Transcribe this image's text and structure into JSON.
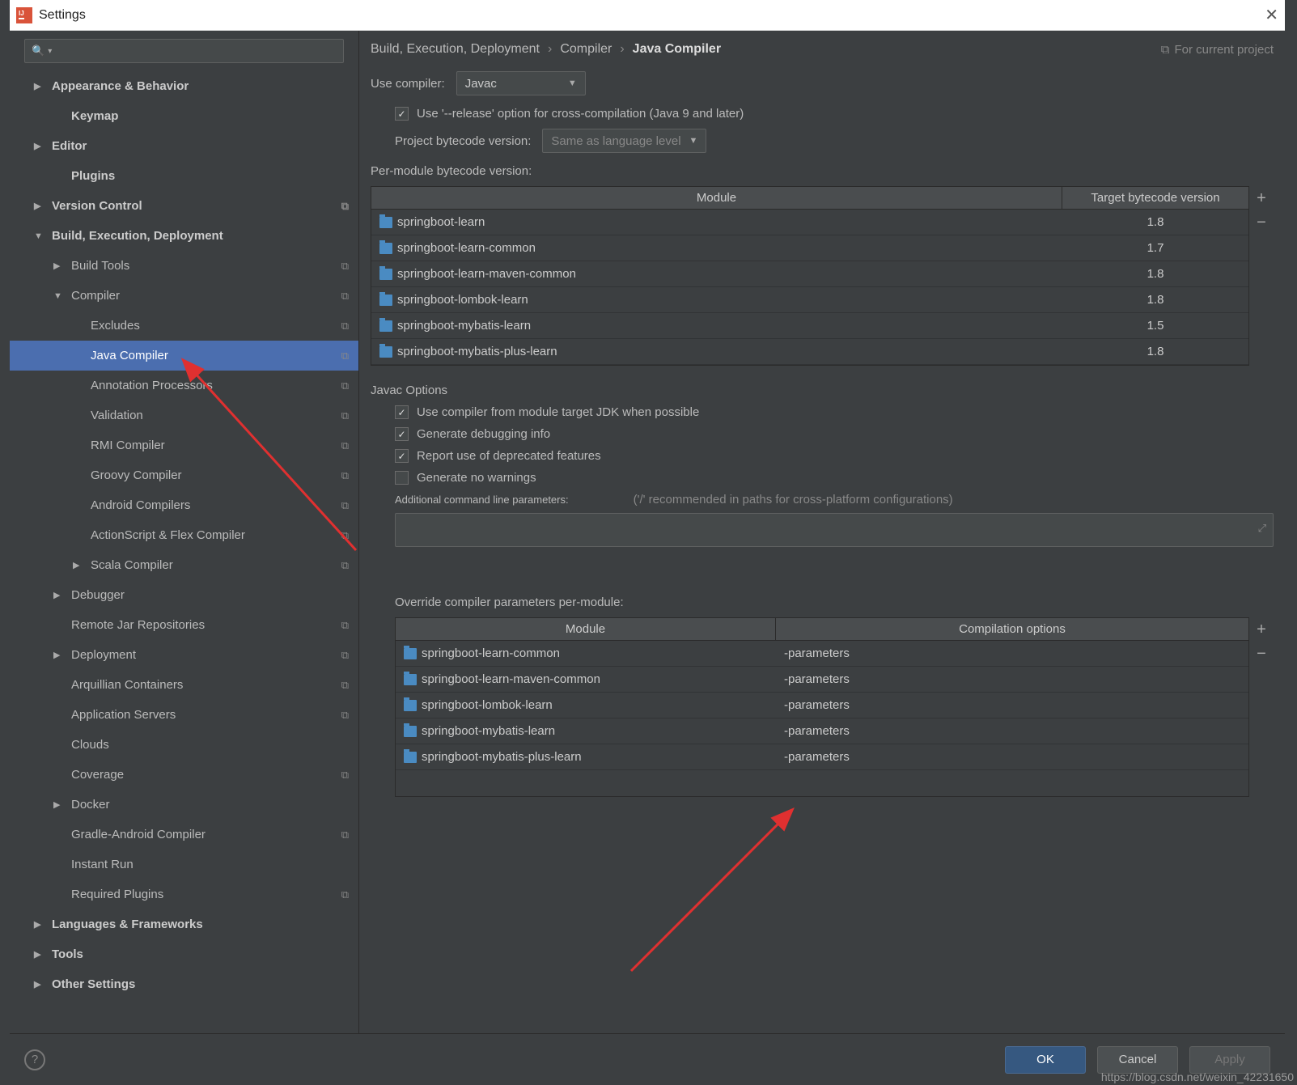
{
  "window": {
    "title": "Settings"
  },
  "sidebar": {
    "search_placeholder": "",
    "items": [
      {
        "label": "Appearance & Behavior",
        "bold": true,
        "exp": "▶",
        "indent": 0
      },
      {
        "label": "Keymap",
        "bold": true,
        "indent": 1
      },
      {
        "label": "Editor",
        "bold": true,
        "exp": "▶",
        "indent": 0
      },
      {
        "label": "Plugins",
        "bold": true,
        "indent": 1
      },
      {
        "label": "Version Control",
        "bold": true,
        "exp": "▶",
        "indent": 0,
        "copy": true
      },
      {
        "label": "Build, Execution, Deployment",
        "bold": true,
        "exp": "▼",
        "indent": 0
      },
      {
        "label": "Build Tools",
        "exp": "▶",
        "indent": 1,
        "copy": true
      },
      {
        "label": "Compiler",
        "exp": "▼",
        "indent": 1,
        "copy": true
      },
      {
        "label": "Excludes",
        "indent": 2,
        "copy": true
      },
      {
        "label": "Java Compiler",
        "indent": 2,
        "copy": true,
        "selected": true
      },
      {
        "label": "Annotation Processors",
        "indent": 2,
        "copy": true
      },
      {
        "label": "Validation",
        "indent": 2,
        "copy": true
      },
      {
        "label": "RMI Compiler",
        "indent": 2,
        "copy": true
      },
      {
        "label": "Groovy Compiler",
        "indent": 2,
        "copy": true
      },
      {
        "label": "Android Compilers",
        "indent": 2,
        "copy": true
      },
      {
        "label": "ActionScript & Flex Compiler",
        "indent": 2,
        "copy": true
      },
      {
        "label": "Scala Compiler",
        "exp": "▶",
        "indent": 2,
        "copy": true
      },
      {
        "label": "Debugger",
        "exp": "▶",
        "indent": 1
      },
      {
        "label": "Remote Jar Repositories",
        "indent": 1,
        "copy": true
      },
      {
        "label": "Deployment",
        "exp": "▶",
        "indent": 1,
        "copy": true
      },
      {
        "label": "Arquillian Containers",
        "indent": 1,
        "copy": true
      },
      {
        "label": "Application Servers",
        "indent": 1,
        "copy": true
      },
      {
        "label": "Clouds",
        "indent": 1
      },
      {
        "label": "Coverage",
        "indent": 1,
        "copy": true
      },
      {
        "label": "Docker",
        "exp": "▶",
        "indent": 1
      },
      {
        "label": "Gradle-Android Compiler",
        "indent": 1,
        "copy": true
      },
      {
        "label": "Instant Run",
        "indent": 1
      },
      {
        "label": "Required Plugins",
        "indent": 1,
        "copy": true
      },
      {
        "label": "Languages & Frameworks",
        "bold": true,
        "exp": "▶",
        "indent": 0
      },
      {
        "label": "Tools",
        "bold": true,
        "exp": "▶",
        "indent": 0
      },
      {
        "label": "Other Settings",
        "bold": true,
        "exp": "▶",
        "indent": 0
      }
    ]
  },
  "breadcrumb": {
    "a": "Build, Execution, Deployment",
    "b": "Compiler",
    "c": "Java Compiler",
    "proj": "For current project"
  },
  "labels": {
    "use_compiler": "Use compiler:",
    "compiler_value": "Javac",
    "release_option": "Use '--release' option for cross-compilation (Java 9 and later)",
    "project_bytecode": "Project bytecode version:",
    "project_bytecode_value": "Same as language level",
    "per_module": "Per-module bytecode version:",
    "th_module": "Module",
    "th_version": "Target bytecode version",
    "javac_options": "Javac Options",
    "o1": "Use compiler from module target JDK when possible",
    "o2": "Generate debugging info",
    "o3": "Report use of deprecated features",
    "o4": "Generate no warnings",
    "additional": "Additional command line parameters:",
    "hint": "('/' recommended in paths for cross-platform configurations)",
    "override": "Override compiler parameters per-module:",
    "th_module2": "Module",
    "th_opts": "Compilation options"
  },
  "bytecode_table": [
    {
      "module": "springboot-learn",
      "ver": "1.8"
    },
    {
      "module": "springboot-learn-common",
      "ver": "1.7"
    },
    {
      "module": "springboot-learn-maven-common",
      "ver": "1.8"
    },
    {
      "module": "springboot-lombok-learn",
      "ver": "1.8"
    },
    {
      "module": "springboot-mybatis-learn",
      "ver": "1.5"
    },
    {
      "module": "springboot-mybatis-plus-learn",
      "ver": "1.8"
    }
  ],
  "override_table": [
    {
      "module": "springboot-learn-common",
      "opts": "-parameters"
    },
    {
      "module": "springboot-learn-maven-common",
      "opts": "-parameters"
    },
    {
      "module": "springboot-lombok-learn",
      "opts": "-parameters"
    },
    {
      "module": "springboot-mybatis-learn",
      "opts": "-parameters"
    },
    {
      "module": "springboot-mybatis-plus-learn",
      "opts": "-parameters"
    }
  ],
  "footer": {
    "ok": "OK",
    "cancel": "Cancel",
    "apply": "Apply"
  },
  "watermark": "https://blog.csdn.net/weixin_42231650"
}
